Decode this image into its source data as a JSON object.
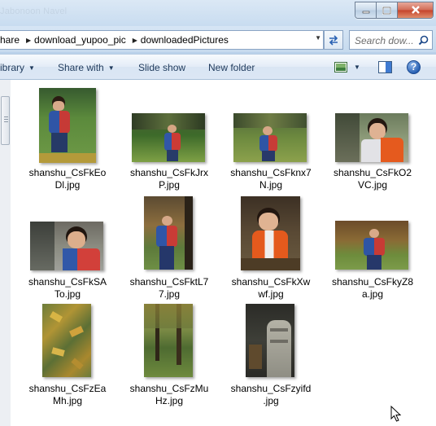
{
  "window": {
    "title": "Jabonoon Navel"
  },
  "address": {
    "crumbs": [
      "hare",
      "download_yupoo_pic",
      "downloadedPictures"
    ],
    "search_placeholder": "Search dow..."
  },
  "toolbar": {
    "library_label": "ibrary",
    "share_label": "Share with",
    "slideshow_label": "Slide show",
    "newfolder_label": "New folder"
  },
  "files": [
    {
      "name": "shanshu_CsFkEo\nDl.jpg"
    },
    {
      "name": "shanshu_CsFkJrx\nP.jpg"
    },
    {
      "name": "shanshu_CsFknx7\nN.jpg"
    },
    {
      "name": "shanshu_CsFkO2\nVC.jpg"
    },
    {
      "name": "shanshu_CsFkSA\nTo.jpg"
    },
    {
      "name": "shanshu_CsFktL7\n7.jpg"
    },
    {
      "name": "shanshu_CsFkXw\nwf.jpg"
    },
    {
      "name": "shanshu_CsFkyZ8\na.jpg"
    },
    {
      "name": "shanshu_CsFzEa\nMh.jpg"
    },
    {
      "name": "shanshu_CsFzMu\nHz.jpg"
    },
    {
      "name": "shanshu_CsFzyifd\n.jpg"
    }
  ],
  "colors": {
    "accent": "#1e395b",
    "close_red": "#c5422a",
    "frame": "#b9d1ea"
  }
}
